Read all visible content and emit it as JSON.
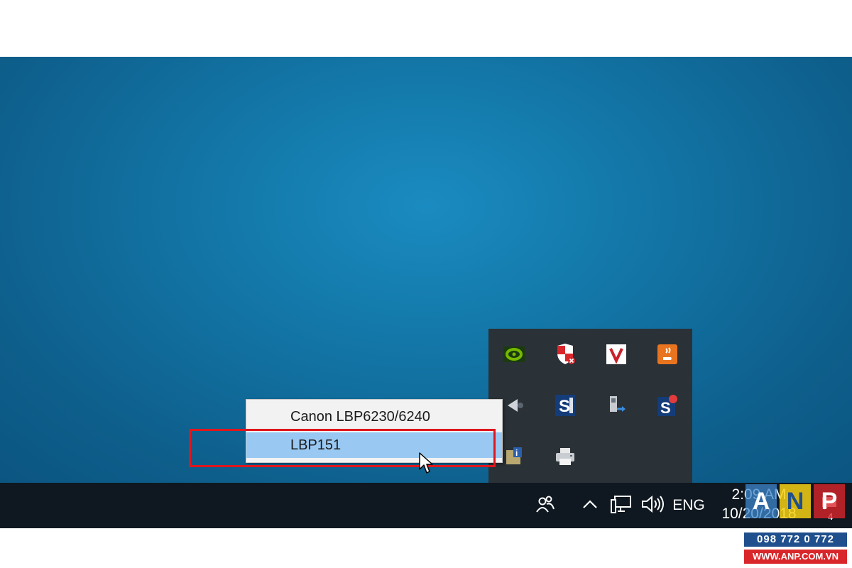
{
  "context_menu": {
    "items": [
      {
        "label": "Canon LBP6230/6240",
        "state": "normal"
      },
      {
        "label": "LBP151",
        "state": "hover"
      }
    ]
  },
  "tray_overflow": {
    "icons": [
      "nvidia-icon",
      "security-shield-icon",
      "v-app-icon",
      "java-icon",
      "media-icon",
      "s-app-icon",
      "usb-device-icon",
      "s-app-badge-icon",
      "info-device-icon",
      "printer-icon"
    ]
  },
  "taskbar": {
    "people_icon": "people-icon",
    "show_hidden_icon": "chevron-up-icon",
    "network_icon": "network-icon",
    "volume_icon": "volume-icon",
    "language": "ENG",
    "clock": {
      "time": "2:09 AM",
      "date": "10/20/2018"
    },
    "notification_count": "4"
  },
  "watermark": {
    "letters": [
      "A",
      "N",
      "P"
    ],
    "phone": "098 772 0 772",
    "website": "WWW.ANP.COM.VN"
  },
  "colors": {
    "desktop": "#1377a8",
    "taskbar": "#0f1820",
    "menu_hover": "#99c9f2",
    "highlight_box": "#e0161d"
  }
}
